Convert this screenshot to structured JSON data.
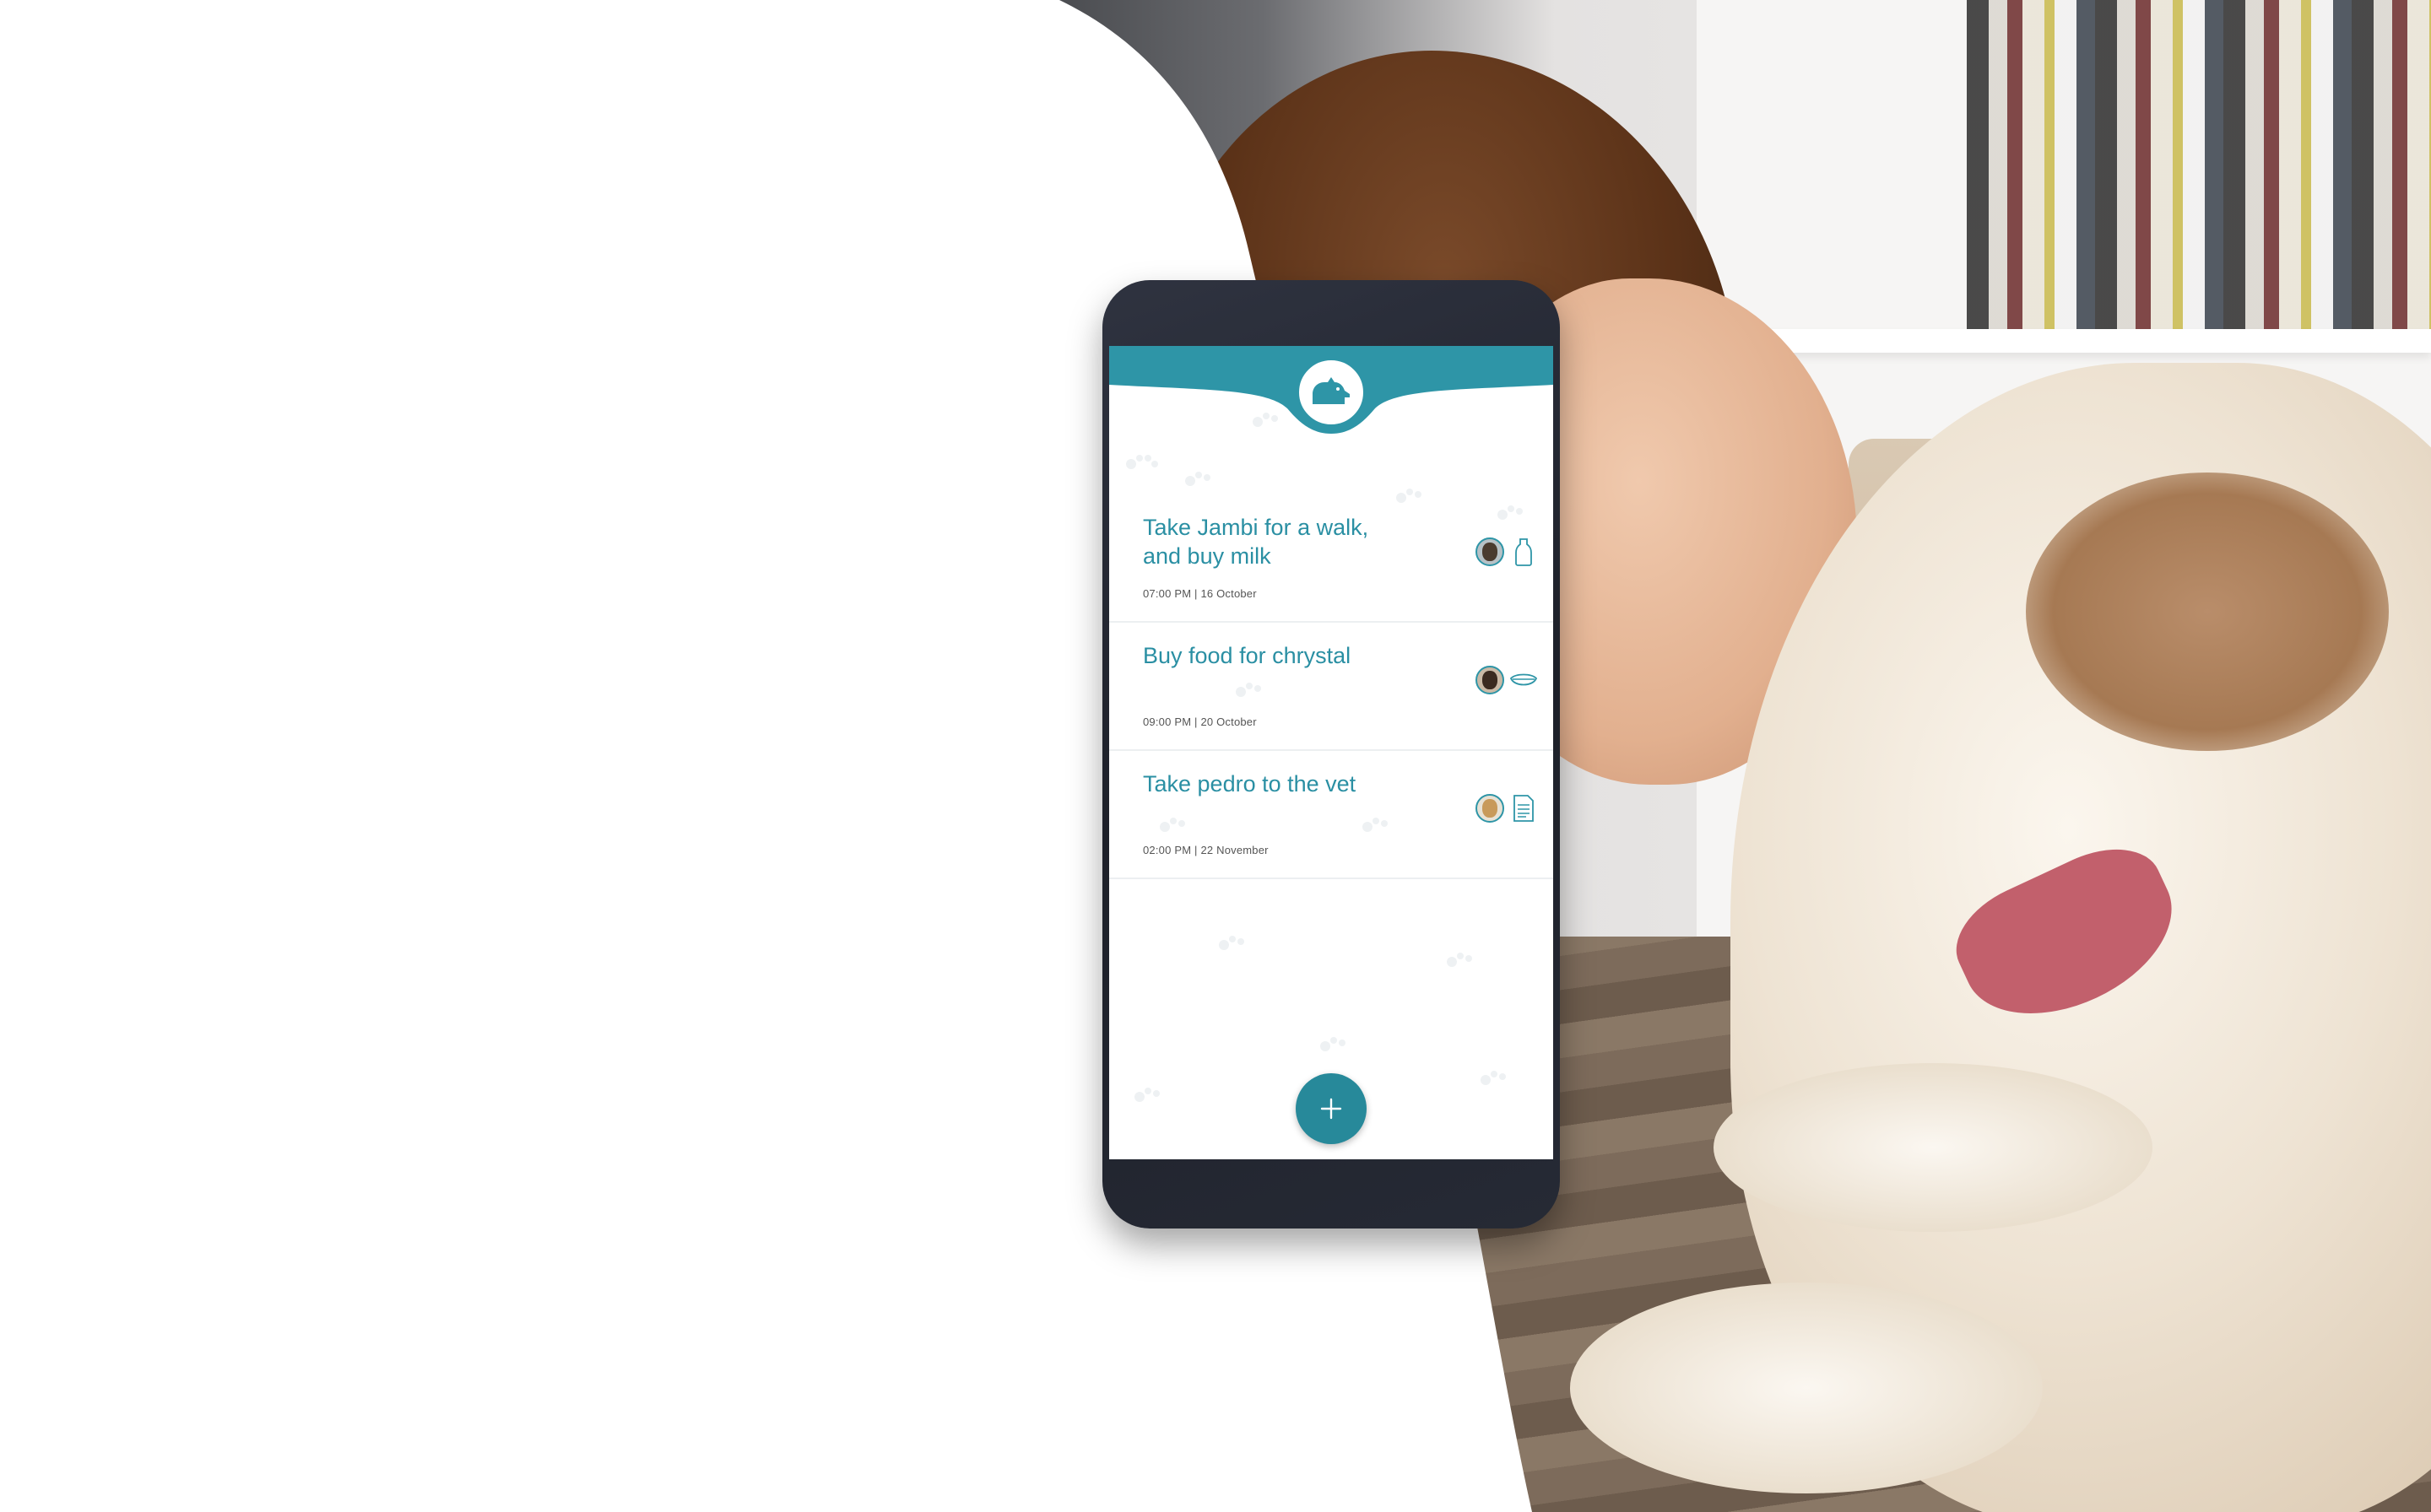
{
  "app": {
    "logo_icon": "dog-icon",
    "accent_color": "#2e95a7",
    "fab_color": "#27899a"
  },
  "tasks": [
    {
      "title": "Take Jambi for a walk, and buy milk",
      "time": "07:00 PM | 16 October",
      "avatar_icon": "dog-avatar",
      "item_icon": "milk-bottle-icon"
    },
    {
      "title": "Buy food for chrystal",
      "time": "09:00 PM | 20 October",
      "avatar_icon": "dog-avatar",
      "item_icon": "food-bowl-icon"
    },
    {
      "title": "Take pedro to the vet",
      "time": "02:00 PM | 22 November",
      "avatar_icon": "dog-avatar",
      "item_icon": "document-icon"
    }
  ],
  "fab": {
    "icon": "plus-icon"
  }
}
